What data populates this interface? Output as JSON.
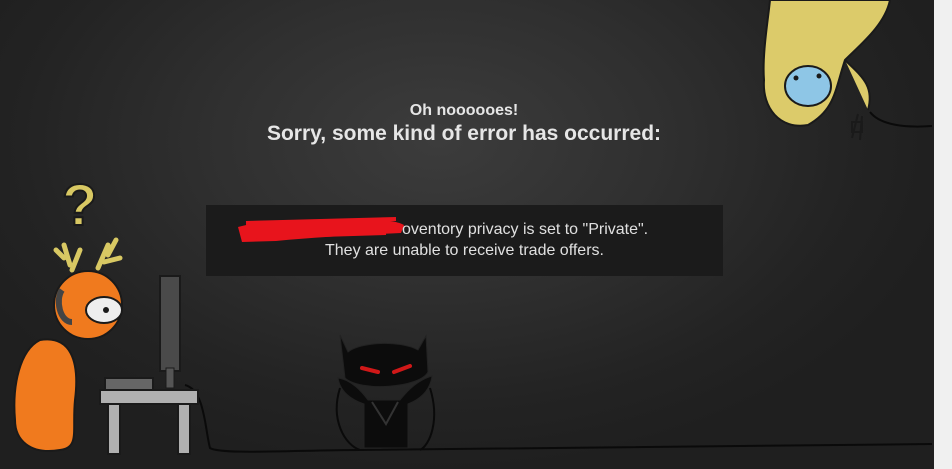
{
  "error": {
    "subtitle": "Oh noooooes!",
    "title": "Sorry, some kind of error has occurred:",
    "message_line1": "oventory privacy is set to \"Private\".",
    "message_line2": "They are unable to receive trade offers."
  },
  "illustration": {
    "question_mark": "?"
  },
  "colors": {
    "background": "#2f2f2f",
    "message_box": "#1b1b1b",
    "redaction": "#e8141c",
    "deer": "#f07a1e",
    "ghost": "#e0cf6a",
    "cat": "#0c0c0c"
  }
}
